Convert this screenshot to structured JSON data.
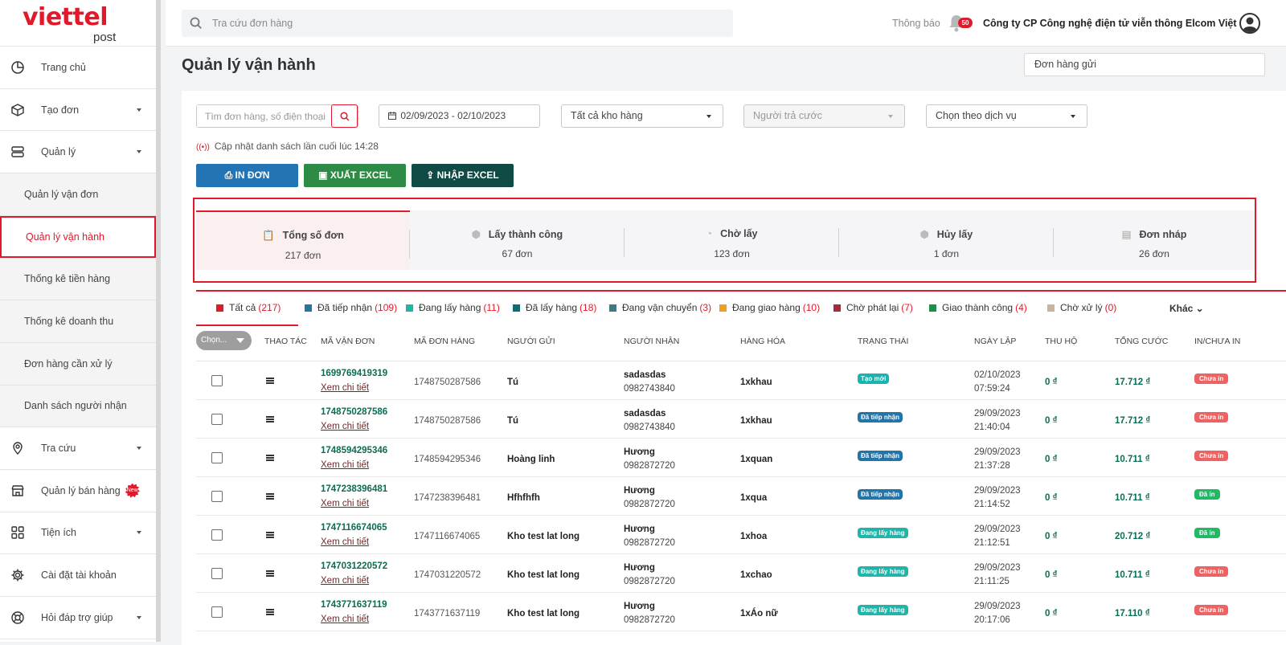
{
  "sidebar": {
    "logo_main": "viettel",
    "logo_sub": "post",
    "items": [
      {
        "label": "Trang chủ",
        "icon": "pie-chart-icon"
      },
      {
        "label": "Tạo đơn",
        "icon": "box-icon"
      },
      {
        "label": "Quản lý",
        "icon": "server-icon"
      },
      {
        "label": "Quản lý vận đơn"
      },
      {
        "label": "Quản lý vận hành"
      },
      {
        "label": "Thống kê tiền hàng"
      },
      {
        "label": "Thống kê doanh thu"
      },
      {
        "label": "Đơn hàng cần xử lý"
      },
      {
        "label": "Danh sách người nhận"
      },
      {
        "label": "Tra cứu",
        "icon": "map-pin-icon"
      },
      {
        "label": "Quản lý bán hàng",
        "icon": "store-icon",
        "badge": "New"
      },
      {
        "label": "Tiện ích",
        "icon": "grid-icon"
      },
      {
        "label": "Cài đặt tài khoản",
        "icon": "gear-icon"
      },
      {
        "label": "Hỏi đáp trợ giúp",
        "icon": "lifebuoy-icon"
      }
    ]
  },
  "topbar": {
    "search_placeholder": "Tra cứu đơn hàng",
    "notification_label": "Thông báo",
    "notification_count": "50",
    "company": "Công ty CP Công nghệ điện tử viễn thông Elcom Việt"
  },
  "page": {
    "title": "Quản lý vận hành",
    "order_type": "Đơn hàng gửi"
  },
  "filters": {
    "search_placeholder": "Tìm đơn hàng, số điện thoại",
    "date_range": "02/09/2023 - 02/10/2023",
    "warehouse": "Tất cả kho hàng",
    "payer_placeholder": "Người trả cước",
    "service_placeholder": "Chọn theo dịch vụ",
    "updated": "Cập nhật danh sách lần cuối lúc 14:28"
  },
  "actions": {
    "print": "IN ĐƠN",
    "export": "XUẤT EXCEL",
    "import": "NHẬP EXCEL"
  },
  "summary": [
    {
      "title": "Tổng số đơn",
      "value": "217 đơn"
    },
    {
      "title": "Lấy thành công",
      "value": "67 đơn"
    },
    {
      "title": "Chờ lấy",
      "value": "123 đơn"
    },
    {
      "title": "Hủy lấy",
      "value": "1 đơn"
    },
    {
      "title": "Đơn nháp",
      "value": "26 đơn"
    }
  ],
  "status_tabs": [
    {
      "label": "Tất cả",
      "count": "(217)",
      "color": "#e01a2b"
    },
    {
      "label": "Đã tiếp nhận",
      "count": "(109)",
      "color": "#2375a8"
    },
    {
      "label": "Đang lấy hàng",
      "count": "(11)",
      "color": "#1fb5a8"
    },
    {
      "label": "Đã lấy hàng",
      "count": "(18)",
      "color": "#0d6b72"
    },
    {
      "label": "Đang vận chuyển",
      "count": "(3)",
      "color": "#3f7a80"
    },
    {
      "label": "Đang giao hàng",
      "count": "(10)",
      "color": "#f0a021"
    },
    {
      "label": "Chờ phát lại",
      "count": "(7)",
      "color": "#a62b3a"
    },
    {
      "label": "Giao thành công",
      "count": "(4)",
      "color": "#1e8c4b"
    },
    {
      "label": "Chờ xử lý",
      "count": "(0)",
      "color": "#c9b4a0"
    }
  ],
  "more_label": "Khác",
  "table": {
    "choose_label": "Chọn...",
    "headers": [
      "THAO TÁC",
      "MÃ VẬN ĐƠN",
      "MÃ ĐƠN HÀNG",
      "NGƯỜI GỬI",
      "NGƯỜI NHẬN",
      "HÀNG HÓA",
      "TRẠNG THÁI",
      "NGÀY LẬP",
      "THU HỘ",
      "TỔNG CƯỚC",
      "IN/CHƯA IN"
    ],
    "rows": [
      {
        "ma": "1699769419319",
        "xem": "Xem chi tiết",
        "mdh": "1748750287586",
        "gui": "Tú",
        "nn": "sadasdas",
        "sdt": "0982743840",
        "hh": "1xkhau",
        "tt": "Tạo mới",
        "tt_color": "#19b3b0",
        "d1": "02/10/2023",
        "d2": "07:59:24",
        "thu": "0 ₫",
        "tong": "17.712 ₫",
        "in": "Chưa in",
        "in_color": "#f06161"
      },
      {
        "ma": "1748750287586",
        "xem": "Xem chi tiết",
        "mdh": "1748750287586",
        "gui": "Tú",
        "nn": "sadasdas",
        "sdt": "0982743840",
        "hh": "1xkhau",
        "tt": "Đã tiếp nhận",
        "tt_color": "#2375a8",
        "d1": "29/09/2023",
        "d2": "21:40:04",
        "thu": "0 ₫",
        "tong": "17.712 ₫",
        "in": "Chưa in",
        "in_color": "#f06161"
      },
      {
        "ma": "1748594295346",
        "xem": "Xem chi tiết",
        "mdh": "1748594295346",
        "gui": "Hoàng linh",
        "nn": "Hương",
        "sdt": "0982872720",
        "hh": "1xquan",
        "tt": "Đã tiếp nhận",
        "tt_color": "#2375a8",
        "d1": "29/09/2023",
        "d2": "21:37:28",
        "thu": "0 ₫",
        "tong": "10.711 ₫",
        "in": "Chưa in",
        "in_color": "#f06161"
      },
      {
        "ma": "1747238396481",
        "xem": "Xem chi tiết",
        "mdh": "1747238396481",
        "gui": "Hfhfhfh",
        "nn": "Hương",
        "sdt": "0982872720",
        "hh": "1xqua",
        "tt": "Đã tiếp nhận",
        "tt_color": "#2375a8",
        "d1": "29/09/2023",
        "d2": "21:14:52",
        "thu": "0 ₫",
        "tong": "10.711 ₫",
        "in": "Đã in",
        "in_color": "#22b864"
      },
      {
        "ma": "1747116674065",
        "xem": "Xem chi tiết",
        "mdh": "1747116674065",
        "gui": "Kho test lat long",
        "nn": "Hương",
        "sdt": "0982872720",
        "hh": "1xhoa",
        "tt": "Đang lấy hàng",
        "tt_color": "#1fb5a8",
        "d1": "29/09/2023",
        "d2": "21:12:51",
        "thu": "0 ₫",
        "tong": "20.712 ₫",
        "in": "Đã in",
        "in_color": "#22b864"
      },
      {
        "ma": "1747031220572",
        "xem": "Xem chi tiết",
        "mdh": "1747031220572",
        "gui": "Kho test lat long",
        "nn": "Hương",
        "sdt": "0982872720",
        "hh": "1xchao",
        "tt": "Đang lấy hàng",
        "tt_color": "#1fb5a8",
        "d1": "29/09/2023",
        "d2": "21:11:25",
        "thu": "0 ₫",
        "tong": "10.711 ₫",
        "in": "Chưa in",
        "in_color": "#f06161"
      },
      {
        "ma": "1743771637119",
        "xem": "Xem chi tiết",
        "mdh": "1743771637119",
        "gui": "Kho test lat long",
        "nn": "Hương",
        "sdt": "0982872720",
        "hh": "1xÁo nữ",
        "tt": "Đang lấy hàng",
        "tt_color": "#1fb5a8",
        "d1": "29/09/2023",
        "d2": "20:17:06",
        "thu": "0 ₫",
        "tong": "17.110 ₫",
        "in": "Chưa in",
        "in_color": "#f06161"
      }
    ]
  },
  "colors": {
    "brand": "#e01a2b",
    "print_btn": "#2374b5",
    "export_btn": "#2e8b45",
    "import_btn": "#0f4a45"
  }
}
